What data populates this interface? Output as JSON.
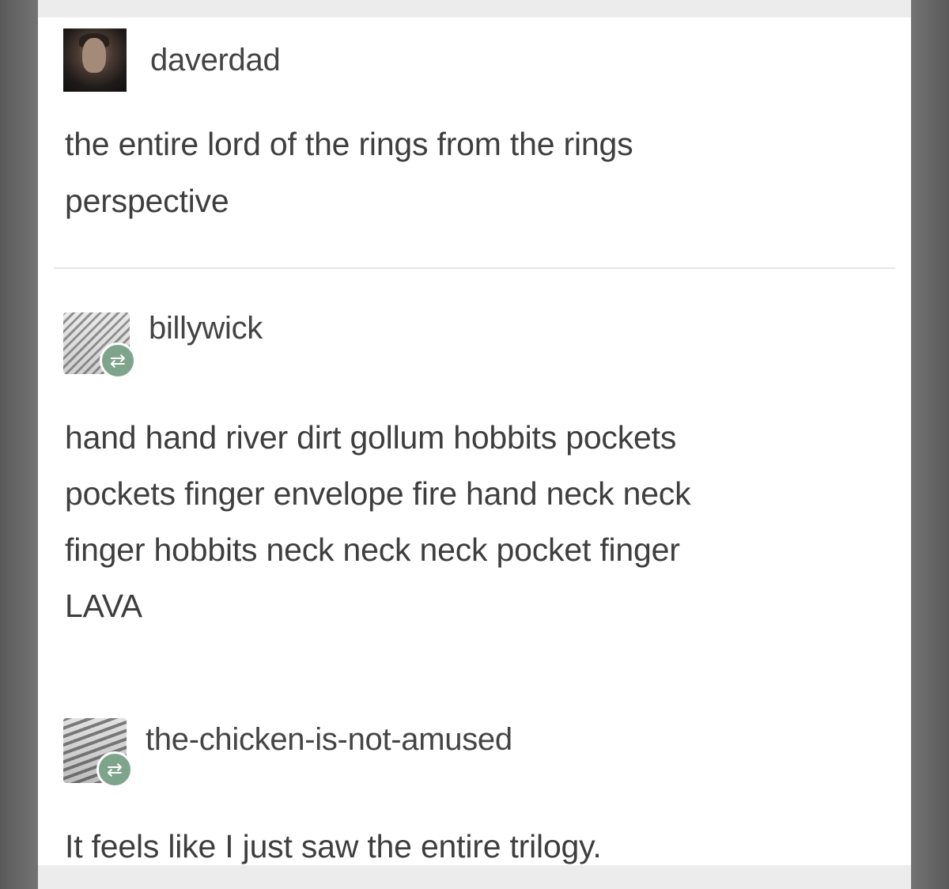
{
  "posts": [
    {
      "username": "daverdad",
      "avatar_icon": "user-avatar-icon",
      "reblog": false,
      "text": "the entire lord of the rings from the rings\nperspective"
    },
    {
      "username": "billywick",
      "avatar_icon": "user-avatar-icon",
      "reblog": true,
      "reblog_icon": "reblog-icon",
      "reblog_glyph": "⇄",
      "text": "hand hand river dirt gollum hobbits pockets\npockets finger envelope fire hand neck neck\nfinger hobbits neck neck neck pocket finger\nLAVA"
    },
    {
      "username": "the-chicken-is-not-amused",
      "avatar_icon": "user-avatar-icon",
      "reblog": true,
      "reblog_icon": "reblog-icon",
      "reblog_glyph": "⇄",
      "text": "It feels like I just saw the entire trilogy."
    }
  ],
  "colors": {
    "background": "#ffffff",
    "text": "#3e3e3e",
    "reblog_badge": "#7fa48c",
    "frame": "#6e6e6e"
  }
}
